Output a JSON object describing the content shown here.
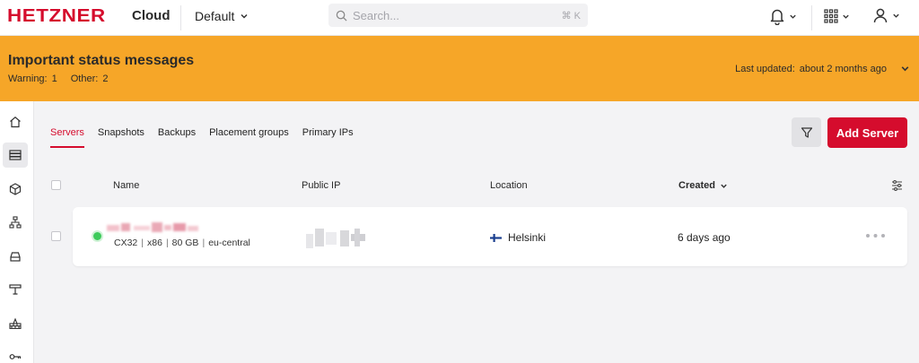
{
  "topbar": {
    "logo_text": "HETZNER",
    "product": "Cloud",
    "project": "Default",
    "search_placeholder": "Search...",
    "search_shortcut": "⌘ K"
  },
  "banner": {
    "title": "Important status messages",
    "warning_label": "Warning:",
    "warning_count": "1",
    "other_label": "Other:",
    "other_count": "2",
    "updated_label": "Last updated:",
    "updated_value": "about 2 months ago",
    "color": "#f6a628"
  },
  "sidebar": {
    "items": [
      {
        "icon": "home-icon"
      },
      {
        "icon": "servers-icon",
        "active": true
      },
      {
        "icon": "box-icon"
      },
      {
        "icon": "network-icon"
      },
      {
        "icon": "volume-icon"
      },
      {
        "icon": "load-balancer-icon"
      },
      {
        "icon": "firewall-icon"
      },
      {
        "icon": "key-icon"
      }
    ]
  },
  "tabs": [
    {
      "label": "Servers",
      "active": true
    },
    {
      "label": "Snapshots"
    },
    {
      "label": "Backups"
    },
    {
      "label": "Placement groups"
    },
    {
      "label": "Primary IPs"
    }
  ],
  "actions": {
    "add_server": "Add Server"
  },
  "table": {
    "headers": {
      "name": "Name",
      "public_ip": "Public IP",
      "location": "Location",
      "created": "Created"
    },
    "rows": [
      {
        "status": "running",
        "type": "CX32",
        "arch": "x86",
        "disk": "80 GB",
        "zone": "eu-central",
        "location": "Helsinki",
        "created": "6 days ago"
      }
    ]
  },
  "colors": {
    "brand": "#d50c2d",
    "status_running": "#3ecb5b"
  }
}
